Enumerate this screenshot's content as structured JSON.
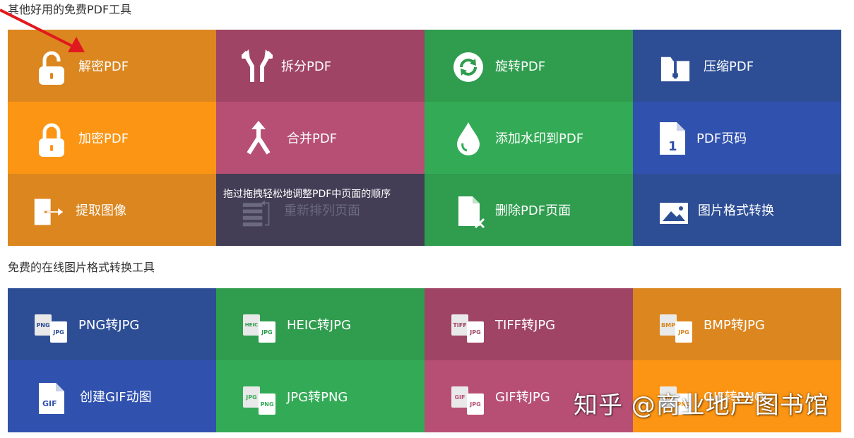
{
  "section1": {
    "title": "其他好用的免费PDF工具"
  },
  "section2": {
    "title": "免费的在线图片格式转换工具"
  },
  "tools": [
    {
      "label": "解密PDF",
      "icon": "unlock-icon"
    },
    {
      "label": "拆分PDF",
      "icon": "split-arrows-icon"
    },
    {
      "label": "旋转PDF",
      "icon": "rotate-icon"
    },
    {
      "label": "压缩PDF",
      "icon": "zip-folder-icon"
    },
    {
      "label": "加密PDF",
      "icon": "lock-icon"
    },
    {
      "label": "合并PDF",
      "icon": "merge-arrows-icon"
    },
    {
      "label": "添加水印到PDF",
      "icon": "water-drop-icon"
    },
    {
      "label": "PDF页码",
      "icon": "page-number-icon"
    },
    {
      "label": "提取图像",
      "icon": "extract-image-icon"
    },
    {
      "label": "重新排列页面",
      "icon": "reorder-pages-icon",
      "tooltip": "拖过拖拽轻松地调整PDF中页面的顺序"
    },
    {
      "label": "删除PDF页面",
      "icon": "delete-page-icon"
    },
    {
      "label": "图片格式转换",
      "icon": "image-icon"
    }
  ],
  "converters": [
    {
      "label": "PNG转JPG",
      "from": "PNG",
      "to": "JPG"
    },
    {
      "label": "HEIC转JPG",
      "from": "HEIC",
      "to": "JPG"
    },
    {
      "label": "TIFF转JPG",
      "from": "TIFF",
      "to": "JPG"
    },
    {
      "label": "BMP转JPG",
      "from": "BMP",
      "to": "JPG"
    },
    {
      "label": "创建GIF动图",
      "from": "GIF",
      "to": ""
    },
    {
      "label": "JPG转PNG",
      "from": "JPG",
      "to": "PNG"
    },
    {
      "label": "GIF转JPG",
      "from": "GIF",
      "to": "JPG"
    },
    {
      "label": "GIF转PNG",
      "from": "GIF",
      "to": "PNG"
    }
  ],
  "watermark": "知乎 @商业地产图书馆",
  "colors": {
    "orange": "#db861f",
    "orange_light": "#fc9513",
    "maroon": "#9f4464",
    "pink": "#b74f74",
    "green": "#2f9c4e",
    "green_light": "#33ab56",
    "navy": "#2d4e95",
    "blue": "#3051ae",
    "dark": "#433e56",
    "annotation_arrow": "#e0191e"
  }
}
